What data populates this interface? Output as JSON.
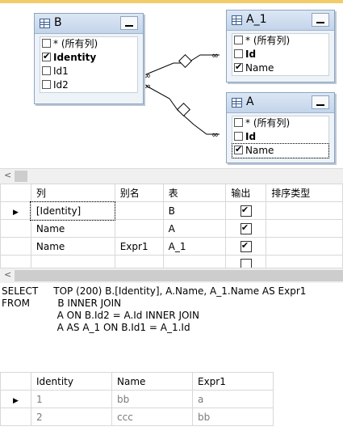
{
  "diagram": {
    "tables": [
      {
        "name": "B",
        "columns": [
          {
            "label": "* (所有列)",
            "checked": false,
            "bold": false
          },
          {
            "label": "Identity",
            "checked": true,
            "bold": true
          },
          {
            "label": "Id1",
            "checked": false,
            "bold": false
          },
          {
            "label": "Id2",
            "checked": false,
            "bold": false
          }
        ]
      },
      {
        "name": "A_1",
        "columns": [
          {
            "label": "* (所有列)",
            "checked": false,
            "bold": false
          },
          {
            "label": "Id",
            "checked": false,
            "bold": true
          },
          {
            "label": "Name",
            "checked": true,
            "bold": false
          }
        ]
      },
      {
        "name": "A",
        "columns": [
          {
            "label": "* (所有列)",
            "checked": false,
            "bold": false
          },
          {
            "label": "Id",
            "checked": false,
            "bold": true
          },
          {
            "label": "Name",
            "checked": true,
            "bold": false
          }
        ]
      }
    ]
  },
  "grid": {
    "headers": [
      "列",
      "别名",
      "表",
      "输出",
      "排序类型"
    ],
    "rows": [
      {
        "column": "[Identity]",
        "alias": "",
        "table": "B",
        "output": true
      },
      {
        "column": "Name",
        "alias": "",
        "table": "A",
        "output": true
      },
      {
        "column": "Name",
        "alias": "Expr1",
        "table": "A_1",
        "output": true
      },
      {
        "column": "",
        "alias": "",
        "table": "",
        "output": false
      }
    ]
  },
  "sql": {
    "lines": [
      "SELECT     TOP (200) B.[Identity], A.Name, A_1.Name AS Expr1",
      "FROM         B INNER JOIN",
      "                  A ON B.Id2 = A.Id INNER JOIN",
      "                  A AS A_1 ON B.Id1 = A_1.Id"
    ]
  },
  "results": {
    "headers": [
      "Identity",
      "Name",
      "Expr1"
    ],
    "rows": [
      [
        "1",
        "bb",
        "a"
      ],
      [
        "2",
        "ccc",
        "bb"
      ]
    ]
  },
  "scroll": {
    "left_arrow": "<"
  }
}
